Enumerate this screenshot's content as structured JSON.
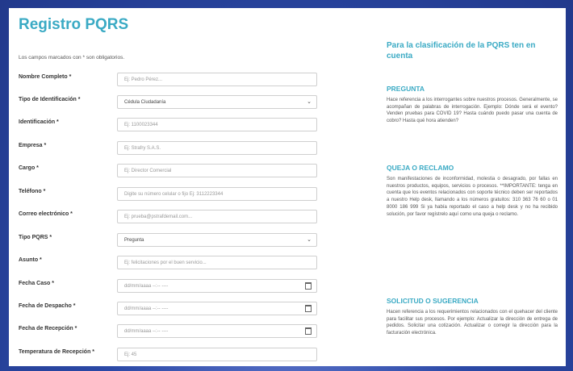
{
  "form": {
    "title": "Registro PQRS",
    "required_note": "Los campos marcados con * son obligatorios.",
    "fields": [
      {
        "label": "Nombre Completo *",
        "value": "Ej: Pedro Pérez...",
        "kind": "text"
      },
      {
        "label": "Tipo de Identificación *",
        "value": "Cédula Ciudadanía",
        "kind": "select"
      },
      {
        "label": "Identificación *",
        "value": "Ej: 1100023344",
        "kind": "text"
      },
      {
        "label": "Empresa *",
        "value": "Ej: Strafry S.A.S.",
        "kind": "text"
      },
      {
        "label": "Cargo *",
        "value": "Ej: Director Comercial",
        "kind": "text"
      },
      {
        "label": "Teléfono *",
        "value": "Digite su número celular o fijo Ej: 3112223344",
        "kind": "text"
      },
      {
        "label": "Correo electrónico *",
        "value": "Ej: prueba@pstrafdemail.com...",
        "kind": "text"
      },
      {
        "label": "Tipo PQRS *",
        "value": "Pregunta",
        "kind": "select"
      },
      {
        "label": "Asunto *",
        "value": "Ej: felicitaciones por el buen servicio...",
        "kind": "text"
      },
      {
        "label": "Fecha Caso *",
        "value": "dd/mm/aaaa --:-- ----",
        "kind": "date"
      },
      {
        "label": "Fecha de Despacho *",
        "value": "dd/mm/aaaa --:-- ----",
        "kind": "date"
      },
      {
        "label": "Fecha de Recepción *",
        "value": "dd/mm/aaaa --:-- ----",
        "kind": "date"
      },
      {
        "label": "Temperatura de Recepción *",
        "value": "Ej: 45",
        "kind": "text"
      }
    ]
  },
  "sidebar": {
    "heading": "Para la clasificación de la PQRS ten en cuenta",
    "sections": [
      {
        "title": "PREGUNTA",
        "body": "Hace referencia a los interrogantes sobre nuestros procesos. Generalmente, se acompañan de palabras de interrogación. Ejemplo: Dónde será el evento? Venden pruebas para COVID 19? Hasta cuándo puedo pasar una cuenta de cobro? Hasta qué hora atienden?"
      },
      {
        "title": "QUEJA O RECLAMO",
        "body": "Son manifestaciones de inconformidad, molestia o desagrado, por fallas en nuestros productos, equipos, servicios o procesos. **IMPORTANTE: tenga en cuenta que los eventos relacionados con soporte técnico deben ser reportados a nuestro Help desk, llamando a los números gratuitos: 310 363 76 60 o 01 8000 186 999 Si ya había reportado el caso a help desk y no ha recibido solución, por favor regístrelo aquí como una queja o reclamo."
      },
      {
        "title": "SOLICITUD O SUGERENCIA",
        "body": "Hacen referencia a los requerimientos relacionados con el quehacer del cliente para facilitar sus procesos. Por ejemplo: Actualizar la dirección de entrega de pedidos. Solicitar una cotización. Actualizar o corregir la dirección para la facturación electrónica."
      }
    ]
  }
}
